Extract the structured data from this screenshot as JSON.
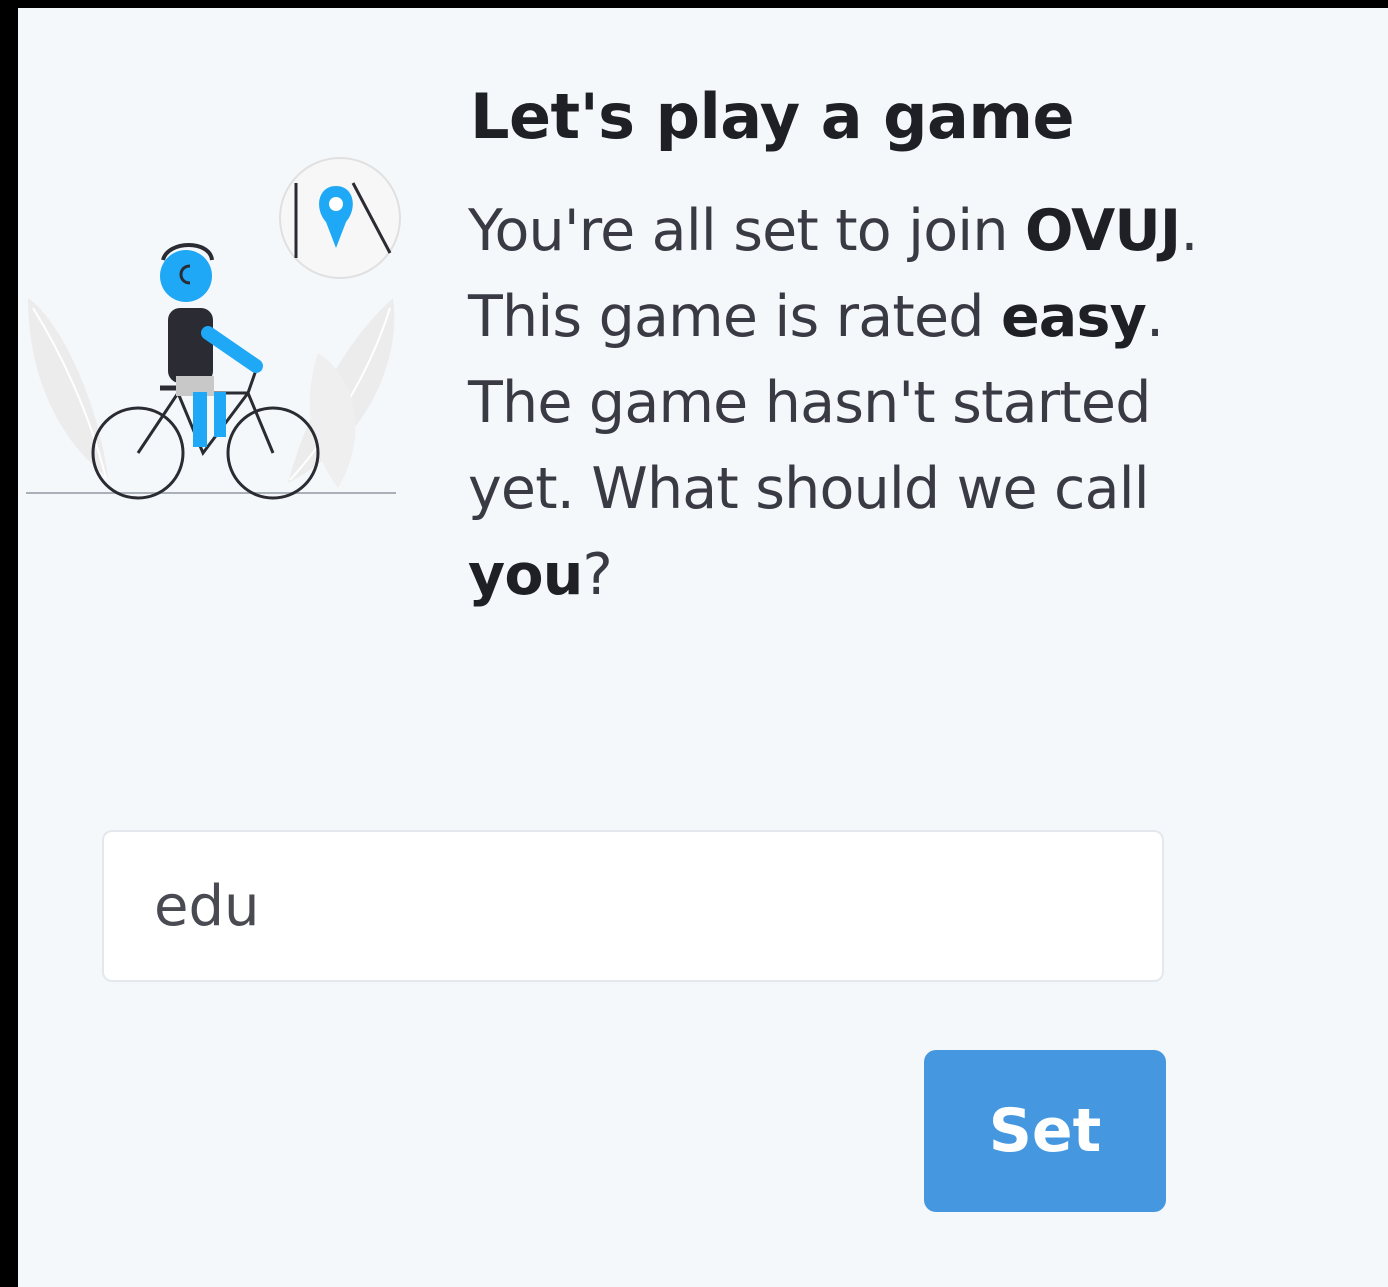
{
  "intro": {
    "title": "Let's play a game",
    "line1_prefix": "You're all set to join ",
    "game_code": "OVUJ",
    "line1_suffix": ".",
    "line2_prefix": " This game is rated ",
    "difficulty": "easy",
    "line2_suffix": ".",
    "line3": " The game hasn't started yet. What should we call ",
    "you_word": "you",
    "question_mark": "?"
  },
  "name_form": {
    "input_value": "edu",
    "submit_label": "Set"
  },
  "illustration": {
    "icons": [
      "cyclist-illustration",
      "map-pin-icon"
    ],
    "accent_color": "#1fa8f5"
  },
  "colors": {
    "button": "#4598e0",
    "background": "#f5f8fb"
  }
}
